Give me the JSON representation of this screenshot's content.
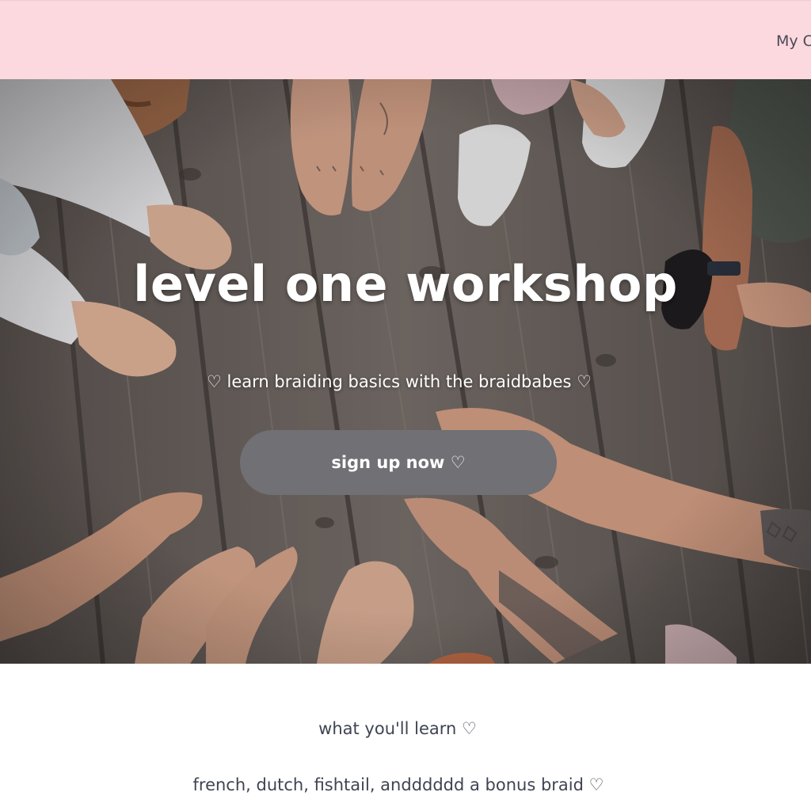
{
  "nav": {
    "account_link": "My C"
  },
  "hero": {
    "title": "level one workshop",
    "subtitle": "♡ learn braiding basics with the braidbabes ♡",
    "cta_label": "sign up now ♡",
    "image_icon": "hands-in-circle-photo"
  },
  "content": {
    "learn_heading": "what you'll learn ♡",
    "learn_list": "french, dutch, fishtail, andddddd a bonus braid ♡"
  },
  "colors": {
    "topbar_bg": "#fbd9df",
    "button_bg": "#707075",
    "text_dark": "#3f4452"
  }
}
